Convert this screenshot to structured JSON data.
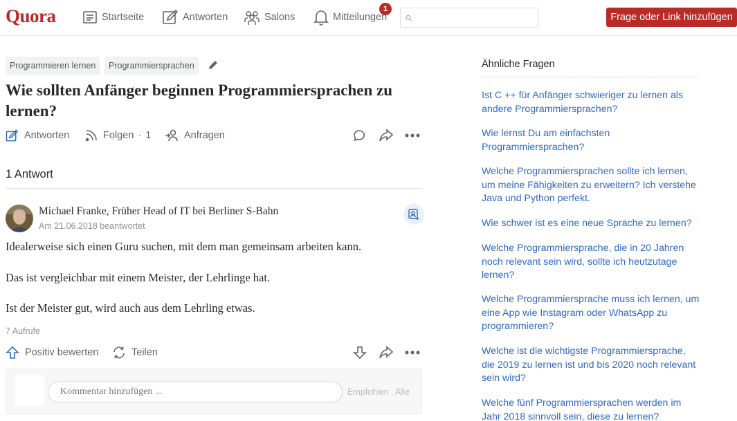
{
  "header": {
    "logo": "Quora",
    "nav": [
      {
        "label": "Startseite",
        "icon": "home-feed-icon"
      },
      {
        "label": "Antworten",
        "icon": "pencil-square-icon"
      },
      {
        "label": "Salons",
        "icon": "people-icon"
      },
      {
        "label": "Mitteilungen",
        "icon": "bell-icon"
      }
    ],
    "notification_count": "1",
    "search_placeholder": "",
    "ask_button": "Frage oder Link hinzufügen",
    "accent_color": "#b92b27"
  },
  "question": {
    "topics": [
      "Programmieren lernen",
      "Programmiersprachen"
    ],
    "title": "Wie sollten Anfänger beginnen Programmiersprachen zu lernen?",
    "actions": {
      "answer": "Antworten",
      "follow": "Folgen",
      "follow_sep": "·",
      "follow_count": "1",
      "request": "Anfragen"
    }
  },
  "answers_heading": "1 Antwort",
  "answer": {
    "author": "Michael Franke, Früher Head of IT bei Berliner S-Bahn",
    "meta": "Am 21.06.2018 beantwortet",
    "paragraphs": [
      "Idealerweise sich einen Guru suchen, mit dem man gemeinsam arbeiten kann.",
      "Das ist vergleichbar mit einem Meister, der Lehrlinge hat.",
      "Ist der Meister gut, wird auch aus dem Lehrling etwas."
    ],
    "views": "7 Aufrufe",
    "upvote": "Positiv bewerten",
    "share": "Teilen"
  },
  "comment": {
    "placeholder": "Kommentar hinzufügen ...",
    "tab_recommended": "Empfohlen",
    "tab_all": "Alle"
  },
  "sidebar": {
    "heading": "Ähnliche Fragen",
    "links": [
      {
        "lines": [
          "Ist C ++ für Anfänger schwieriger zu lernen als",
          "andere Programmiersprachen?"
        ]
      },
      {
        "lines": [
          "Wie lernst Du am einfachsten",
          "Programmiersprachen?"
        ]
      },
      {
        "lines": [
          "Welche Programmiersprachen sollte ich lernen,",
          "um meine Fähigkeiten zu erweitern? Ich verstehe",
          "Java und Python perfekt."
        ]
      },
      {
        "lines": [
          "Wie schwer ist es eine neue Sprache zu lernen?"
        ]
      },
      {
        "lines": [
          "Welche Programmiersprache, die in 20 Jahren",
          "noch relevant sein wird, sollte ich heutzutage",
          "lernen?"
        ]
      },
      {
        "lines": [
          "Welche Programmiersprache muss ich lernen, um",
          "eine App wie Instagram oder WhatsApp zu",
          "programmieren?"
        ]
      },
      {
        "lines": [
          "Welche ist die wichtigste Programmiersprache,",
          "die 2019 zu lernen ist und bis 2020 noch relevant",
          "sein wird?"
        ]
      },
      {
        "lines": [
          "Welche fünf Programmiersprachen werden im",
          "Jahr 2018 sinnvoll sein, diese zu lernen?"
        ]
      }
    ],
    "link_color": "#2e69c4"
  }
}
